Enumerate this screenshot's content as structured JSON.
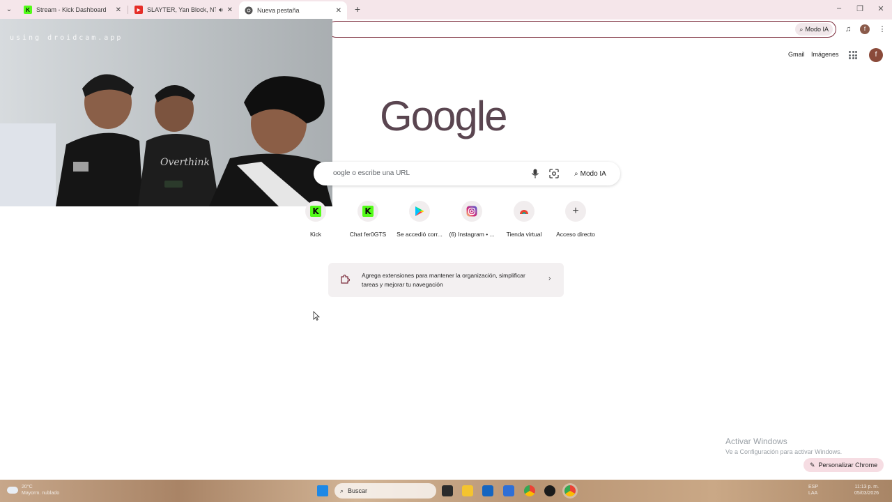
{
  "tabs": [
    {
      "title": "Stream - Kick Dashboard",
      "favicon": "kick-icon"
    },
    {
      "title": "SLAYTER, Yan Block, NTG - S",
      "favicon": "youtube-icon",
      "audio": true
    },
    {
      "title": "Nueva pestaña",
      "favicon": "chrome-icon",
      "active": true
    }
  ],
  "toolbar": {
    "omnibox_ai_label": "Modo IA",
    "profile_initial": "f"
  },
  "webcam": {
    "watermark": "using droidcam.app"
  },
  "ntp": {
    "gmail_label": "Gmail",
    "images_label": "Imágenes",
    "avatar_initial": "f",
    "logo_text": "Google",
    "search_placeholder": "oogle o escribe una URL",
    "search_ai_label": "Modo IA",
    "shortcuts": [
      {
        "label": "Kick",
        "icon": "kick-icon"
      },
      {
        "label": "Chat fer0GTS",
        "icon": "kick-icon"
      },
      {
        "label": "Se accedió corr...",
        "icon": "google-play-icon"
      },
      {
        "label": "(6) Instagram • ...",
        "icon": "instagram-icon"
      },
      {
        "label": "Tienda virtual",
        "icon": "chrome-web-store-icon"
      },
      {
        "label": "Acceso directo",
        "icon": "plus-icon"
      }
    ],
    "extension_card_text": "Agrega extensiones para mantener la organización, simplificar tareas y mejorar tu navegación",
    "customize_label": "Personalizar Chrome"
  },
  "activation": {
    "title": "Activar Windows",
    "subtitle": "Ve a Configuración para activar Windows."
  },
  "taskbar": {
    "weather_temp": "20°C",
    "weather_desc": "Mayorm. nublado",
    "search_label": "Buscar",
    "tray_lang": "ESP",
    "tray_region": "LAA",
    "time": "11:13 p. m.",
    "date": "05/03/2026"
  },
  "colors": {
    "tabstrip_bg": "#f5e6ea",
    "omnibox_border": "#7a2a3a",
    "kick_green": "#53fc18",
    "google_logo": "#5a4550"
  }
}
